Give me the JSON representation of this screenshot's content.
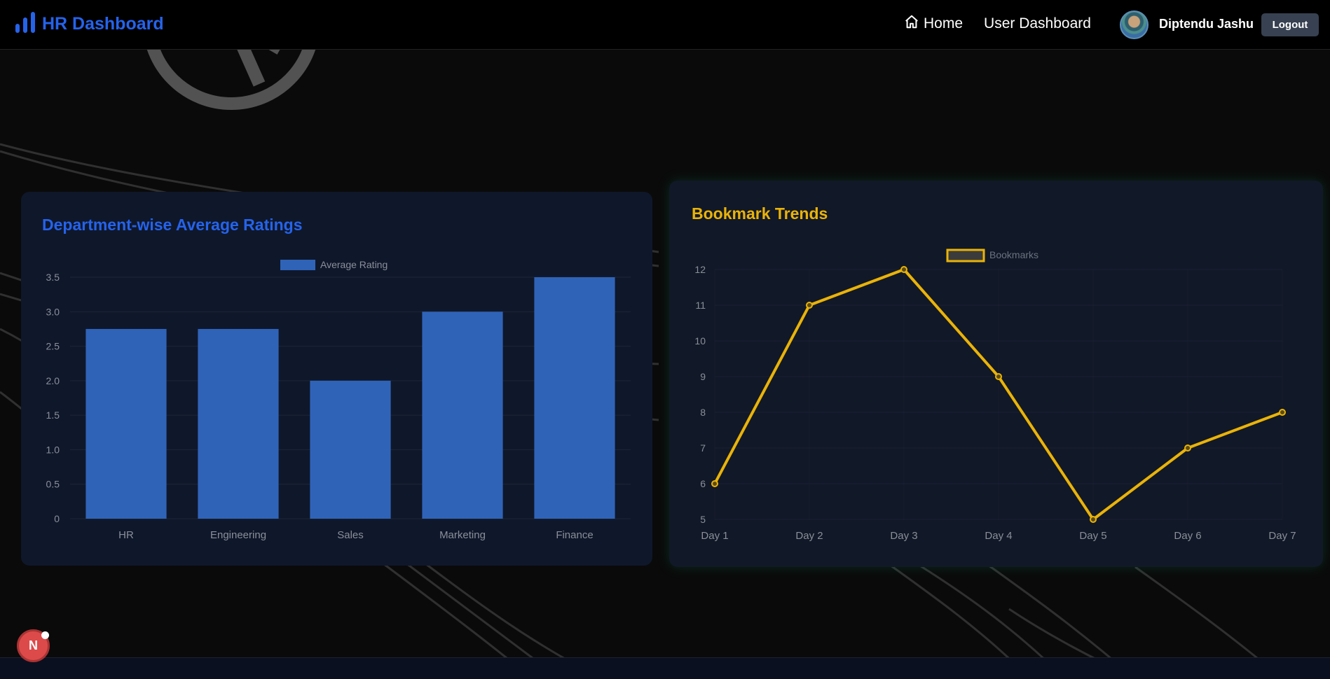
{
  "header": {
    "brand_title": "HR Dashboard",
    "nav_home": "Home",
    "nav_user_dashboard": "User Dashboard",
    "user_name": "Diptendu Jashu",
    "logout_label": "Logout"
  },
  "icons": {
    "brand": "bar-chart-icon",
    "home": "home-icon",
    "fab": "nextjs-icon"
  },
  "fab_label": "N",
  "colors": {
    "brand": "#2563eb",
    "bar_fill": "#2f63b8",
    "line": "#eab308",
    "right_title": "#eab308"
  },
  "chart_data": [
    {
      "type": "bar",
      "title": "Department-wise Average Ratings",
      "categories": [
        "HR",
        "Engineering",
        "Sales",
        "Marketing",
        "Finance"
      ],
      "series": [
        {
          "name": "Average Rating",
          "values": [
            2.75,
            2.75,
            2.0,
            3.0,
            3.5
          ]
        }
      ],
      "ylim": [
        0,
        3.5
      ],
      "yticks": [
        "0",
        "0.5",
        "1.0",
        "1.5",
        "2.0",
        "2.5",
        "3.0",
        "3.5"
      ],
      "legend": "top"
    },
    {
      "type": "line",
      "title": "Bookmark Trends",
      "categories": [
        "Day 1",
        "Day 2",
        "Day 3",
        "Day 4",
        "Day 5",
        "Day 6",
        "Day 7"
      ],
      "series": [
        {
          "name": "Bookmarks",
          "values": [
            6,
            11,
            12,
            9,
            5,
            7,
            8
          ]
        }
      ],
      "ylim": [
        5,
        12
      ],
      "yticks": [
        "5",
        "6",
        "7",
        "8",
        "9",
        "10",
        "11",
        "12"
      ],
      "legend": "top"
    }
  ]
}
